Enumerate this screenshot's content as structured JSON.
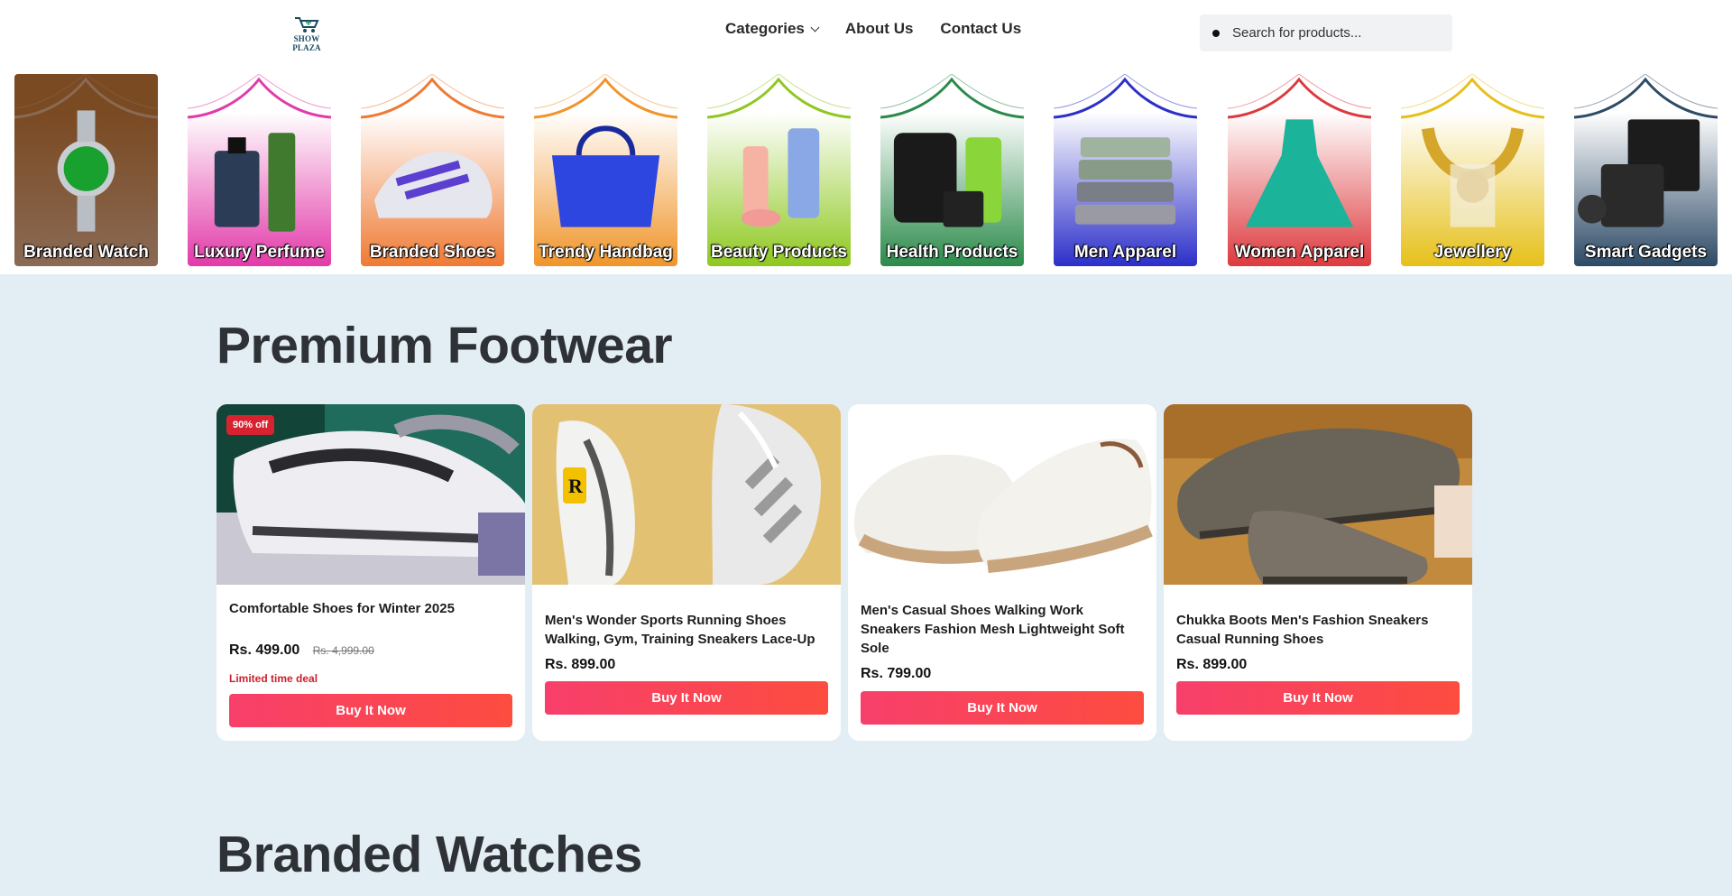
{
  "header": {
    "logo_text": "SHOW PLAZA",
    "nav": {
      "categories": "Categories",
      "about": "About Us",
      "contact": "Contact Us"
    },
    "search_placeholder": "Search for products..."
  },
  "categories": [
    {
      "label": "Branded Watch",
      "color_top": "#7a4a22",
      "color_bottom": "#8a6a55",
      "icon": "watch-icon"
    },
    {
      "label": "Luxury Perfume",
      "color_top": "#ffffff",
      "color_bottom": "#e23aa9",
      "icon": "perfume-icon"
    },
    {
      "label": "Branded Shoes",
      "color_top": "#ffffff",
      "color_bottom": "#ef7a33",
      "icon": "shoe-icon"
    },
    {
      "label": "Trendy Handbag",
      "color_top": "#ffffff",
      "color_bottom": "#f0952a",
      "icon": "handbag-icon"
    },
    {
      "label": "Beauty Products",
      "color_top": "#ffffff",
      "color_bottom": "#8ec81f",
      "icon": "cosmetics-icon"
    },
    {
      "label": "Health Products",
      "color_top": "#ffffff",
      "color_bottom": "#2b8a4a",
      "icon": "supplement-icon"
    },
    {
      "label": "Men Apparel",
      "color_top": "#ffffff",
      "color_bottom": "#2c2fc9",
      "icon": "shirt-icon"
    },
    {
      "label": "Women Apparel",
      "color_top": "#ffffff",
      "color_bottom": "#dd3a3e",
      "icon": "dress-icon"
    },
    {
      "label": "Jewellery",
      "color_top": "#ffffff",
      "color_bottom": "#e6c01a",
      "icon": "necklace-icon"
    },
    {
      "label": "Smart Gadgets",
      "color_top": "#ffffff",
      "color_bottom": "#2d4a66",
      "icon": "gadgets-icon"
    }
  ],
  "footwear": {
    "title": "Premium Footwear",
    "products": [
      {
        "name": "Comfortable Shoes for Winter 2025",
        "price": "Rs. 499.00",
        "old_price": "Rs. 4,999.00",
        "badge": "90% off",
        "deal": "Limited time deal",
        "button": "Buy It Now"
      },
      {
        "name": "Men's Wonder Sports Running Shoes Walking, Gym, Training Sneakers Lace-Up",
        "price": "Rs. 899.00",
        "button": "Buy It Now"
      },
      {
        "name": "Men's Casual Shoes Walking Work Sneakers Fashion Mesh Lightweight Soft Sole",
        "price": "Rs. 799.00",
        "button": "Buy It Now"
      },
      {
        "name": "Chukka Boots Men's Fashion Sneakers Casual Running Shoes",
        "price": "Rs. 899.00",
        "button": "Buy It Now"
      }
    ]
  },
  "watches": {
    "title": "Branded Watches"
  },
  "colors": {
    "page_bg": "#e2edf4",
    "button_start": "#f73f6b",
    "button_end": "#fd4c3f",
    "deal_red": "#cc1f2b"
  }
}
